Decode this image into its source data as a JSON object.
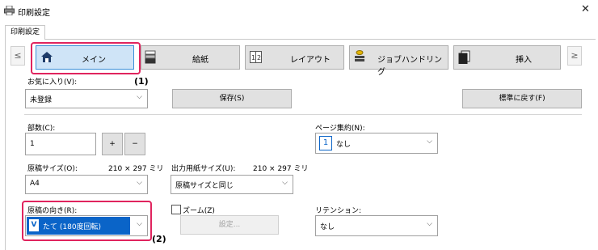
{
  "window": {
    "title": "印刷設定",
    "close_glyph": "✕"
  },
  "tab": {
    "label": "印刷設定"
  },
  "nav": {
    "prev": "≤",
    "next": "≥",
    "buttons": [
      {
        "label": "メイン",
        "icon": "home-icon"
      },
      {
        "label": "給紙",
        "icon": "paper-tray-icon"
      },
      {
        "label": "レイアウト",
        "icon": "layout-icon"
      },
      {
        "label": "ジョブハンドリング",
        "icon": "job-handling-icon"
      },
      {
        "label": "挿入",
        "icon": "insert-icon"
      }
    ]
  },
  "favorites": {
    "label": "お気に入り(V):",
    "value": "未登録",
    "save": "保存(S)",
    "reset": "標準に戻す(F)"
  },
  "copies": {
    "label": "部数(C):",
    "value": "1",
    "plus": "+",
    "minus": "−"
  },
  "page_aggregation": {
    "label": "ページ集約(N):",
    "badge": "1",
    "value": "なし"
  },
  "original_size": {
    "label": "原稿サイズ(O):",
    "dims": "210 × 297 ミリ",
    "value": "A4"
  },
  "output_size": {
    "label": "出力用紙サイズ(U):",
    "dims": "210 × 297 ミリ",
    "value": "原稿サイズと同じ"
  },
  "orientation": {
    "label": "原稿の向き(R):",
    "value": "たて (180度回転)"
  },
  "zoom": {
    "label": "ズーム(Z)",
    "settings": "設定..."
  },
  "retention": {
    "label": "リテンション:",
    "value": "なし"
  },
  "callouts": {
    "one": "(1)",
    "two": "(2)"
  },
  "colors": {
    "accent": "#0a64c8",
    "highlight": "#e0245e",
    "selected_bg": "#cfe4f7"
  }
}
